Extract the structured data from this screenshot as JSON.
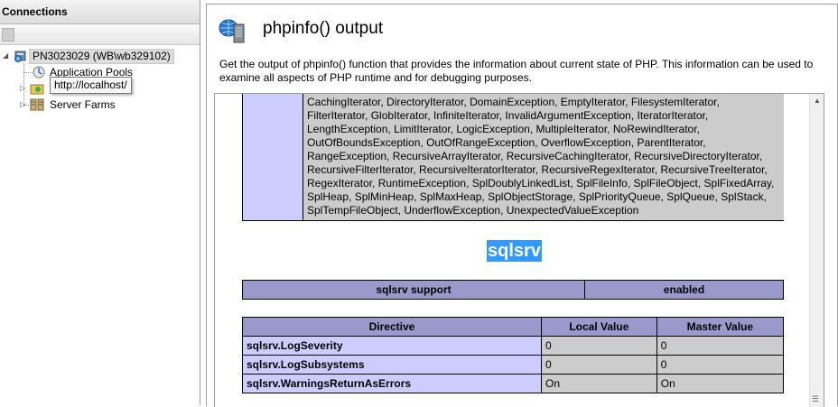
{
  "connections": {
    "header": "Connections",
    "tree": {
      "server": "PN3023029 (WB\\wb329102)",
      "app_pools": "Application Pools",
      "server_farms": "Server Farms"
    },
    "tooltip": "http://localhost/"
  },
  "page": {
    "title": "phpinfo() output",
    "description": "Get the output of phpinfo() function that provides the information about current state of PHP. This information can be used to examine all aspects of PHP runtime and for debugging purposes."
  },
  "phpinfo": {
    "classes_lines": [
      "CachingIterator, DirectoryIterator, DomainException, EmptyIterator, FilesystemIterator,",
      "FilterIterator, GlobIterator, InfiniteIterator, InvalidArgumentException, IteratorIterator,",
      "LengthException, LimitIterator, LogicException, MultipleIterator, NoRewindIterator,",
      "OutOfBoundsException, OutOfRangeException, OverflowException, ParentIterator,",
      "RangeException, RecursiveArrayIterator, RecursiveCachingIterator, RecursiveDirectoryIterator,",
      "RecursiveFilterIterator, RecursiveIteratorIterator, RecursiveRegexIterator, RecursiveTreeIterator,",
      "RegexIterator, RuntimeException, SplDoublyLinkedList, SplFileInfo, SplFileObject, SplFixedArray,",
      "SplHeap, SplMinHeap, SplMaxHeap, SplObjectStorage, SplPriorityQueue, SplQueue, SplStack,",
      "SplTempFileObject, UnderflowException, UnexpectedValueException"
    ],
    "module_name": "sqlsrv",
    "support": {
      "label": "sqlsrv support",
      "value": "enabled"
    },
    "directive_headers": {
      "directive": "Directive",
      "local": "Local Value",
      "master": "Master Value"
    },
    "directives": [
      {
        "name": "sqlsrv.LogSeverity",
        "local": "0",
        "master": "0"
      },
      {
        "name": "sqlsrv.LogSubsystems",
        "local": "0",
        "master": "0"
      },
      {
        "name": "sqlsrv.WarningsReturnAsErrors",
        "local": "On",
        "master": "On"
      }
    ]
  }
}
